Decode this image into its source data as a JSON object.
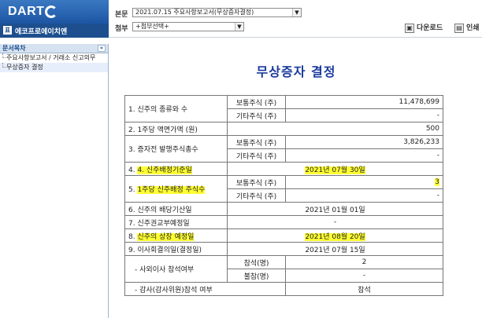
{
  "header": {
    "logo": "DART",
    "company": "에코프로에이치엔",
    "company_icon": "표",
    "main_doc_label": "본문",
    "main_doc_value": "2021.07.15  주요사항보고서(무상증자결정)",
    "attach_label": "첨부",
    "attach_value": "+첨부선택+",
    "download_label": "다운로드",
    "print_label": "인쇄"
  },
  "sidebar": {
    "title": "문서목차",
    "collapse": "«",
    "items": [
      {
        "label": "주요사항보고서 / 거래소 신고의무"
      },
      {
        "label": "무상증자 결정"
      }
    ]
  },
  "document": {
    "title": "무상증자 결정",
    "rows": {
      "r1": {
        "label": "1. 신주의 종류와 수",
        "sub1": "보통주식 (주)",
        "val1": "11,478,699",
        "sub2": "기타주식 (주)",
        "val2": "-"
      },
      "r2": {
        "label": "2. 1주당 액면가액 (원)",
        "val": "500"
      },
      "r3": {
        "label": "3. 증자전 발행주식총수",
        "sub1": "보통주식 (주)",
        "val1": "3,826,233",
        "sub2": "기타주식 (주)",
        "val2": "-"
      },
      "r4": {
        "label": "4. 신주배정기준일",
        "val": "2021년 07월 30일"
      },
      "r5": {
        "label_prefix": "5. ",
        "label": "1주당 신주배정 주식수",
        "sub1": "보통주식 (주)",
        "val1": "3",
        "sub2": "기타주식 (주)",
        "val2": "-"
      },
      "r6": {
        "label": "6. 신주의 배당기산일",
        "val": "2021년 01월 01일"
      },
      "r7": {
        "label": "7. 신주권교부예정일",
        "val": "-"
      },
      "r8": {
        "label_prefix": "8. ",
        "label": "신주의 상장 예정일",
        "val": "2021년 08월 20일"
      },
      "r9": {
        "label": "9. 이사회결의일(결정일)",
        "val": "2021년 07월 15일"
      },
      "r10": {
        "label": "- 사외이사 참석여부",
        "sub1": "참석(명)",
        "val1": "2",
        "sub2": "불참(명)",
        "val2": "-"
      },
      "r11": {
        "label": "- 감사(감사위원)참석 여부",
        "val": "참석"
      }
    }
  },
  "colors": {
    "highlight": "#ffff33",
    "title": "#1a3a9e",
    "brand": "#1d56a3"
  }
}
